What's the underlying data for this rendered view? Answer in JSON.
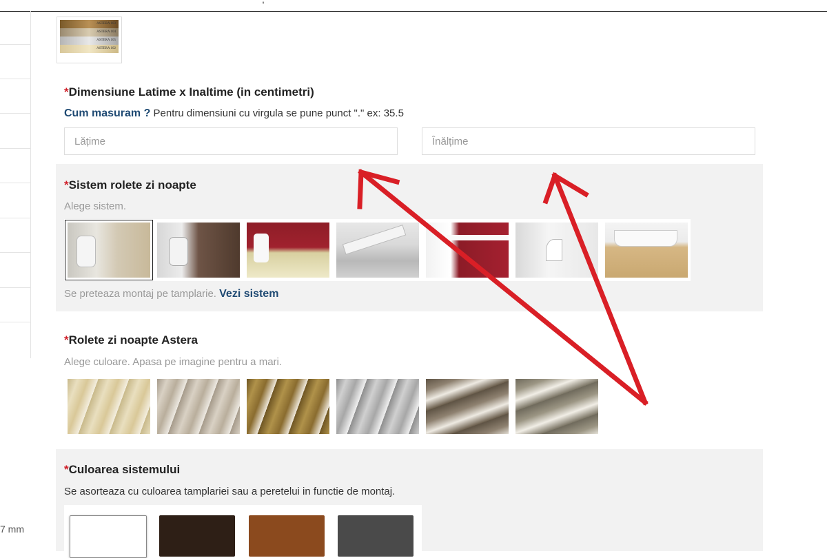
{
  "sidebar": {
    "footer_text": "7 mm"
  },
  "header": {
    "fragment": ","
  },
  "product": {
    "thumbnail_labels": [
      "ASTERA 103",
      "ASTERA 104",
      "ASTERA 105",
      "ASTERA 102"
    ]
  },
  "dimensions": {
    "required_mark": "*",
    "label": "Dimensiune Latime x Inaltime (in centimetri)",
    "measure_link": "Cum masuram ?",
    "hint": "Pentru dimensiuni cu virgula se pune punct \".\" ex: 35.5",
    "width_placeholder": "Lățime",
    "height_placeholder": "Înălțime"
  },
  "system": {
    "required_mark": "*",
    "label": "Sistem rolete zi noapte",
    "hint": "Alege sistem.",
    "selected_index": 0,
    "note": "Se preteaza montaj pe tamplarie.",
    "note_link": "Vezi sistem"
  },
  "fabric": {
    "required_mark": "*",
    "label": "Rolete zi noapte Astera",
    "hint": "Alege culoare. Apasa pe imagine pentru a mari."
  },
  "system_color": {
    "required_mark": "*",
    "label": "Culoarea sistemului",
    "hint": "Se asorteaza cu culoarea tamplariei sau a peretelui in functie de montaj.",
    "options": [
      "#ffffff",
      "#2e1f16",
      "#8b4a1e",
      "#4a4a4a"
    ]
  },
  "annotation": {
    "arrow_color": "#d91f26"
  }
}
